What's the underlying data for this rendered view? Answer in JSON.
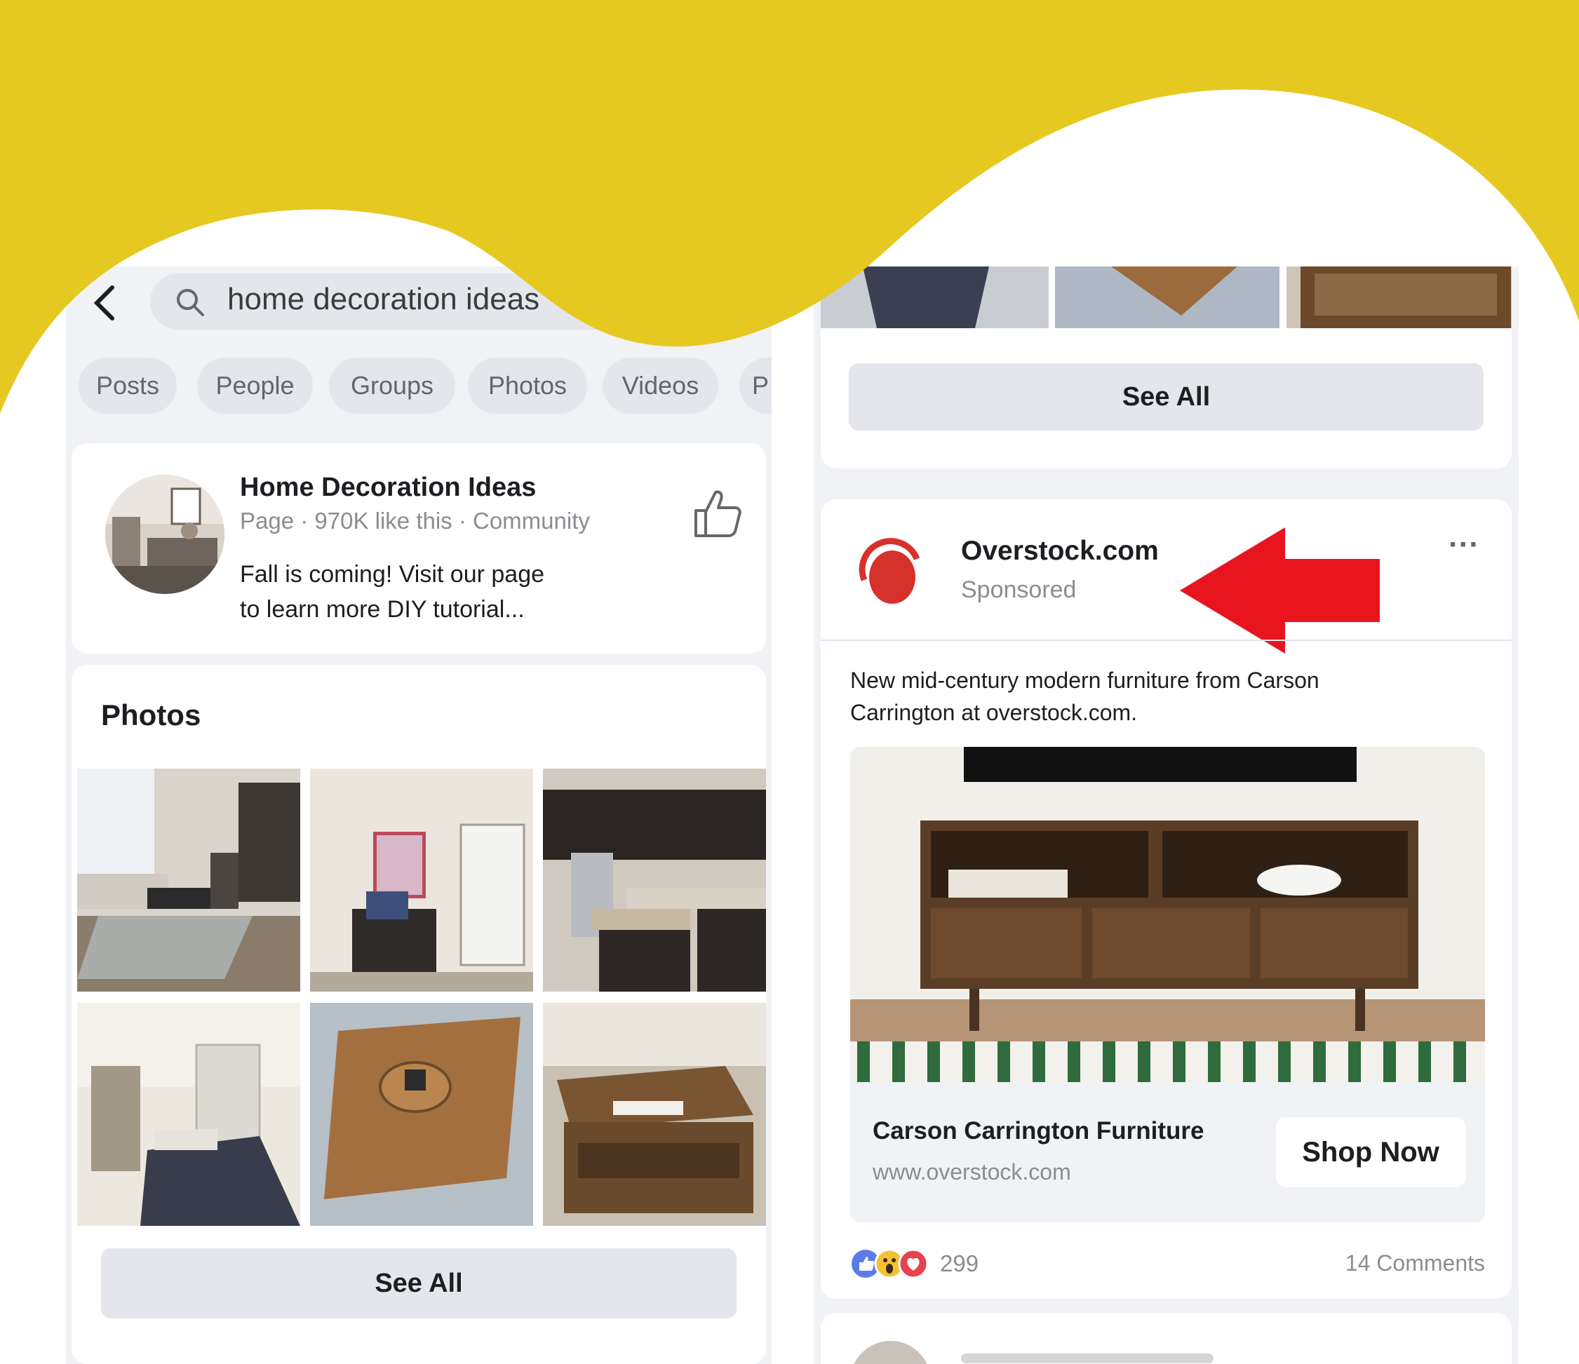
{
  "left": {
    "search": {
      "query": "home decoration ideas"
    },
    "filters": [
      "Posts",
      "People",
      "Groups",
      "Photos",
      "Videos",
      "P"
    ],
    "page_result": {
      "name": "Home Decoration Ideas",
      "meta": "Page · 970K like this · Community",
      "description_line1": "Fall is coming! Visit our page",
      "description_line2": "to learn more DIY tutorial..."
    },
    "photos_section": {
      "title": "Photos",
      "see_all": "See All"
    }
  },
  "right": {
    "top_see_all": "See All",
    "ad": {
      "advertiser": "Overstock.com",
      "sponsored": "Sponsored",
      "text_line1": "New mid-century modern furniture from Carson",
      "text_line2": "Carrington at overstock.com.",
      "headline": "Carson Carrington Furniture",
      "url": "www.overstock.com",
      "cta": "Shop Now",
      "reactions_count": "299",
      "comments": "14 Comments",
      "more_menu": "···"
    }
  },
  "colors": {
    "banner_yellow": "#e5c920",
    "overstock_red": "#d6322b",
    "arrow_red": "#e8151f",
    "like_blue": "#5b7ce8"
  }
}
